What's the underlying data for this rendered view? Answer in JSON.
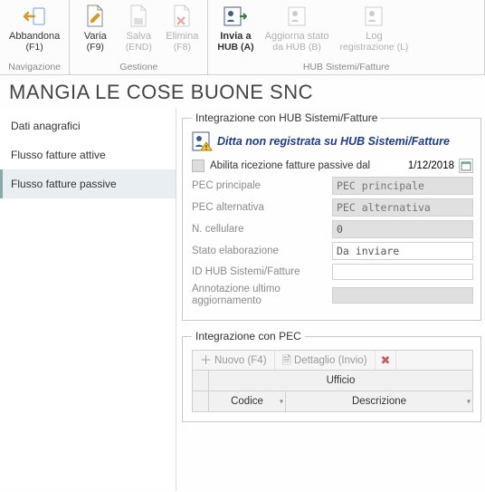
{
  "ribbon": {
    "groups": [
      {
        "caption": "Navigazione",
        "items": [
          {
            "id": "abbandona",
            "label": "Abbandona",
            "shortcut": "(F1)",
            "enabled": true
          }
        ]
      },
      {
        "caption": "Gestione",
        "items": [
          {
            "id": "varia",
            "label": "Varia",
            "shortcut": "(F9)",
            "enabled": true
          },
          {
            "id": "salva",
            "label": "Salva",
            "shortcut": "(END)",
            "enabled": false
          },
          {
            "id": "elimina",
            "label": "Elimina",
            "shortcut": "(F8)",
            "enabled": false
          }
        ]
      },
      {
        "caption": "HUB Sistemi/Fatture",
        "items": [
          {
            "id": "invia",
            "label": "Invia a",
            "shortcut": "HUB (A)",
            "enabled": true
          },
          {
            "id": "aggiorna",
            "label": "Aggiorna stato",
            "shortcut": "da HUB (B)",
            "enabled": false
          },
          {
            "id": "log",
            "label": "Log",
            "shortcut": "registrazione (L)",
            "enabled": false
          }
        ]
      }
    ]
  },
  "title": "MANGIA LE COSE BUONE SNC",
  "sidebar": {
    "items": [
      {
        "id": "anagrafici",
        "label": "Dati anagrafici",
        "selected": false
      },
      {
        "id": "attive",
        "label": "Flusso fatture attive",
        "selected": false
      },
      {
        "id": "passive",
        "label": "Flusso fatture passive",
        "selected": true
      }
    ]
  },
  "section_hub": {
    "legend": "Integrazione con HUB Sistemi/Fatture",
    "warning": "Ditta non registrata su HUB Sistemi/Fatture",
    "enable_label": "Abilita ricezione fatture passive dal",
    "enable_date": "1/12/2018",
    "fields": {
      "pec_principale": {
        "label": "PEC principale",
        "placeholder": "PEC principale",
        "value": ""
      },
      "pec_alternativa": {
        "label": "PEC alternativa",
        "placeholder": "PEC alternativa",
        "value": ""
      },
      "n_cellulare": {
        "label": "N. cellulare",
        "value": "0"
      },
      "stato": {
        "label": "Stato elaborazione",
        "value": "Da inviare"
      },
      "idhub": {
        "label": "ID HUB Sistemi/Fatture",
        "value": ""
      },
      "annot": {
        "label": "Annotazione ultimo aggiornamento",
        "value": ""
      }
    }
  },
  "section_pec": {
    "legend": "Integrazione con PEC",
    "toolbar": {
      "nuovo": "Nuovo (F4)",
      "dettaglio": "Dettaglio (Invio)"
    },
    "grid": {
      "super": "Ufficio",
      "cols": [
        "Codice",
        "Descrizione"
      ]
    }
  }
}
